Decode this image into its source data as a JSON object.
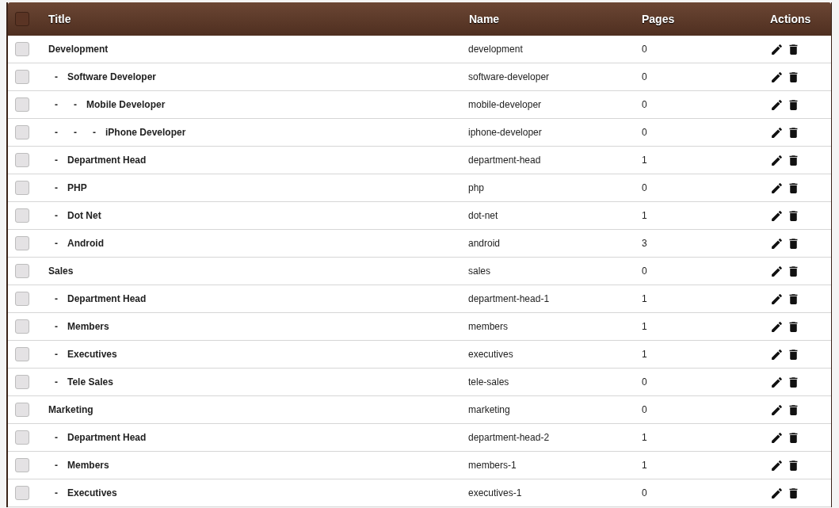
{
  "table": {
    "select_all": {
      "checked": false
    },
    "columns": [
      "Title",
      "Name",
      "Pages",
      "Actions"
    ],
    "rows": [
      {
        "title": "Development",
        "name": "development",
        "pages": "0",
        "checked": false,
        "prefix": [],
        "children": [
          {
            "title": "Software Developer",
            "name": "software-developer",
            "pages": "0",
            "checked": false,
            "prefix": [
              "-"
            ],
            "children": [
              {
                "title": "Mobile Developer",
                "name": "mobile-developer",
                "pages": "0",
                "checked": false,
                "prefix": [
                  "-",
                  "-"
                ],
                "children": [
                  {
                    "title": "iPhone Developer",
                    "name": "iphone-developer",
                    "pages": "0",
                    "checked": false,
                    "prefix": [
                      "-",
                      "-",
                      "-"
                    ]
                  }
                ]
              }
            ]
          },
          {
            "title": "Department Head",
            "name": "department-head",
            "pages": "1",
            "checked": false,
            "prefix": [
              "-"
            ]
          },
          {
            "title": "PHP",
            "name": "php",
            "pages": "0",
            "checked": false,
            "prefix": [
              "-"
            ]
          },
          {
            "title": "Dot Net",
            "name": "dot-net",
            "pages": "1",
            "checked": false,
            "prefix": [
              "-"
            ]
          },
          {
            "title": "Android",
            "name": "android",
            "pages": "3",
            "checked": false,
            "prefix": [
              "-"
            ]
          }
        ]
      },
      {
        "title": "Sales",
        "name": "sales",
        "pages": "0",
        "checked": false,
        "prefix": [],
        "children": [
          {
            "title": "Department Head",
            "name": "department-head-1",
            "pages": "1",
            "checked": false,
            "prefix": [
              "-"
            ]
          },
          {
            "title": "Members",
            "name": "members",
            "pages": "1",
            "checked": false,
            "prefix": [
              "-"
            ]
          },
          {
            "title": "Executives",
            "name": "executives",
            "pages": "1",
            "checked": false,
            "prefix": [
              "-"
            ]
          },
          {
            "title": "Tele Sales",
            "name": "tele-sales",
            "pages": "0",
            "checked": false,
            "prefix": [
              "-"
            ]
          }
        ]
      },
      {
        "title": "Marketing",
        "name": "marketing",
        "pages": "0",
        "checked": false,
        "prefix": [],
        "children": [
          {
            "title": "Department Head",
            "name": "department-head-2",
            "pages": "1",
            "checked": false,
            "prefix": [
              "-"
            ]
          },
          {
            "title": "Members",
            "name": "members-1",
            "pages": "1",
            "checked": false,
            "prefix": [
              "-"
            ]
          },
          {
            "title": "Executives",
            "name": "executives-1",
            "pages": "0",
            "checked": false,
            "prefix": [
              "-"
            ]
          }
        ]
      }
    ]
  }
}
